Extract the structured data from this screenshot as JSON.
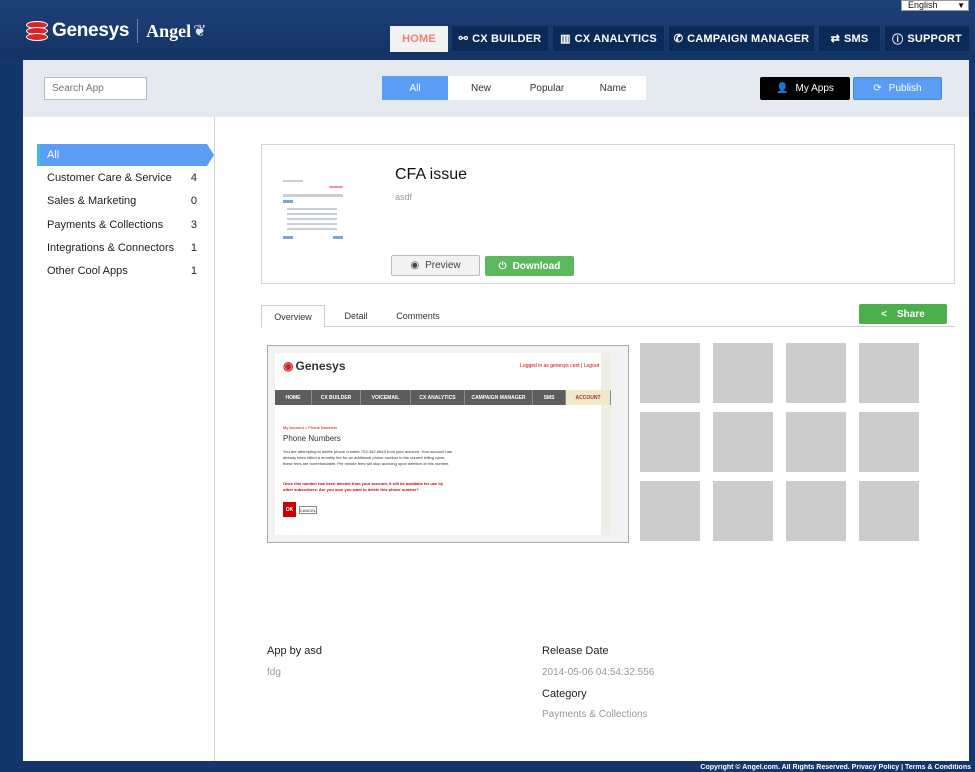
{
  "brand": {
    "name": "Genesys",
    "sub": "Angel"
  },
  "language": {
    "selected": "English"
  },
  "nav": [
    {
      "label": "HOME",
      "icon": "home"
    },
    {
      "label": "CX BUILDER",
      "icon": "share-nodes-icon"
    },
    {
      "label": "CX ANALYTICS",
      "icon": "bar-chart-icon"
    },
    {
      "label": "CAMPAIGN MANAGER",
      "icon": "phone-icon"
    },
    {
      "label": "SMS",
      "icon": "sms-icon"
    },
    {
      "label": "SUPPORT",
      "icon": "info-icon"
    }
  ],
  "toolbar": {
    "search_placeholder": "Search App",
    "filters": [
      "All",
      "New",
      "Popular",
      "Name"
    ],
    "my_apps_label": "My Apps",
    "publish_label": "Publish"
  },
  "categories": [
    {
      "label": "All",
      "count": ""
    },
    {
      "label": "Customer Care & Service",
      "count": "4"
    },
    {
      "label": "Sales & Marketing",
      "count": "0"
    },
    {
      "label": "Payments & Collections",
      "count": "3"
    },
    {
      "label": "Integrations & Connectors",
      "count": "1"
    },
    {
      "label": "Other Cool Apps",
      "count": "1"
    }
  ],
  "app": {
    "title": "CFA issue",
    "description": "asdf",
    "preview_label": "Preview",
    "download_label": "Download"
  },
  "tabs": [
    "Overview",
    "Detail",
    "Comments"
  ],
  "share_label": "Share",
  "screenshot": {
    "logo": "Genesys",
    "login_text": "Logged in as genesys cent | Logout",
    "nav": [
      "HOME",
      "CX BUILDER",
      "VOICEMAIL",
      "CX ANALYTICS",
      "CAMPAIGN MANAGER",
      "SMS",
      "ACCOUNT"
    ],
    "breadcrumb": "My Account > Phone Numbers",
    "heading": "Phone Numbers",
    "paragraph": "You are attempting to delete phone number 703-342-0643 from your account. Your account has already been billed a monthly fee for an additional phone number in the current billing cycle; these fees are nonrefundable. Per minute fees will stop accruing upon deletion of this number.",
    "warning": "Once this number has been deleted from your account, it will be available for use by other subscribers. Are you sure you want to delete this phone number?",
    "ok_label": "OK",
    "cancel_label": "CANCEL"
  },
  "details": {
    "app_by_label": "App by asd",
    "app_by_value": "fdg",
    "release_date_label": "Release Date",
    "release_date_value": "2014-05-06 04:54:32.556",
    "category_label": "Category",
    "category_value": "Payments & Collections"
  },
  "footer": "Copyright © Angel.com. All Rights Reserved. Privacy Policy | Terms & Conditions",
  "colors": {
    "header_bg": "#143466",
    "accent_blue": "#5b9cf5",
    "download_green": "#5cb85c",
    "home_tab_text": "#f08070"
  }
}
